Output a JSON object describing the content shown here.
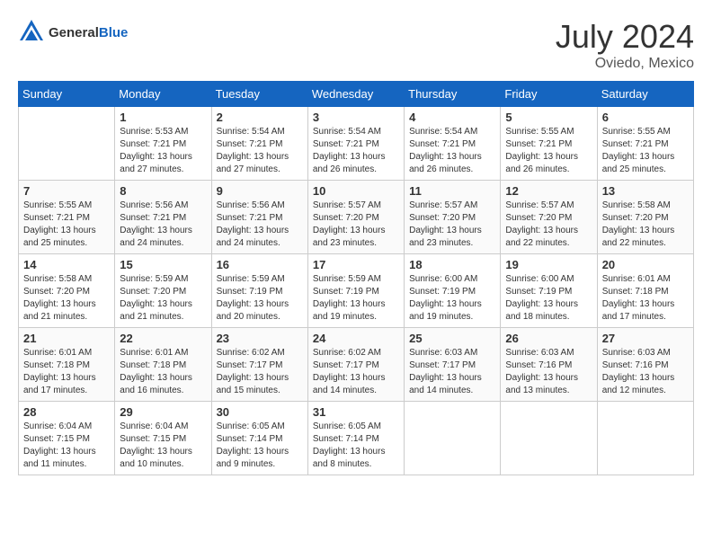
{
  "header": {
    "logo": {
      "general": "General",
      "blue": "Blue"
    },
    "title": "July 2024",
    "location": "Oviedo, Mexico"
  },
  "calendar": {
    "weekdays": [
      "Sunday",
      "Monday",
      "Tuesday",
      "Wednesday",
      "Thursday",
      "Friday",
      "Saturday"
    ],
    "weeks": [
      [
        {
          "day": "",
          "sunrise": "",
          "sunset": "",
          "daylight": ""
        },
        {
          "day": "1",
          "sunrise": "Sunrise: 5:53 AM",
          "sunset": "Sunset: 7:21 PM",
          "daylight": "Daylight: 13 hours and 27 minutes."
        },
        {
          "day": "2",
          "sunrise": "Sunrise: 5:54 AM",
          "sunset": "Sunset: 7:21 PM",
          "daylight": "Daylight: 13 hours and 27 minutes."
        },
        {
          "day": "3",
          "sunrise": "Sunrise: 5:54 AM",
          "sunset": "Sunset: 7:21 PM",
          "daylight": "Daylight: 13 hours and 26 minutes."
        },
        {
          "day": "4",
          "sunrise": "Sunrise: 5:54 AM",
          "sunset": "Sunset: 7:21 PM",
          "daylight": "Daylight: 13 hours and 26 minutes."
        },
        {
          "day": "5",
          "sunrise": "Sunrise: 5:55 AM",
          "sunset": "Sunset: 7:21 PM",
          "daylight": "Daylight: 13 hours and 26 minutes."
        },
        {
          "day": "6",
          "sunrise": "Sunrise: 5:55 AM",
          "sunset": "Sunset: 7:21 PM",
          "daylight": "Daylight: 13 hours and 25 minutes."
        }
      ],
      [
        {
          "day": "7",
          "sunrise": "Sunrise: 5:55 AM",
          "sunset": "Sunset: 7:21 PM",
          "daylight": "Daylight: 13 hours and 25 minutes."
        },
        {
          "day": "8",
          "sunrise": "Sunrise: 5:56 AM",
          "sunset": "Sunset: 7:21 PM",
          "daylight": "Daylight: 13 hours and 24 minutes."
        },
        {
          "day": "9",
          "sunrise": "Sunrise: 5:56 AM",
          "sunset": "Sunset: 7:21 PM",
          "daylight": "Daylight: 13 hours and 24 minutes."
        },
        {
          "day": "10",
          "sunrise": "Sunrise: 5:57 AM",
          "sunset": "Sunset: 7:20 PM",
          "daylight": "Daylight: 13 hours and 23 minutes."
        },
        {
          "day": "11",
          "sunrise": "Sunrise: 5:57 AM",
          "sunset": "Sunset: 7:20 PM",
          "daylight": "Daylight: 13 hours and 23 minutes."
        },
        {
          "day": "12",
          "sunrise": "Sunrise: 5:57 AM",
          "sunset": "Sunset: 7:20 PM",
          "daylight": "Daylight: 13 hours and 22 minutes."
        },
        {
          "day": "13",
          "sunrise": "Sunrise: 5:58 AM",
          "sunset": "Sunset: 7:20 PM",
          "daylight": "Daylight: 13 hours and 22 minutes."
        }
      ],
      [
        {
          "day": "14",
          "sunrise": "Sunrise: 5:58 AM",
          "sunset": "Sunset: 7:20 PM",
          "daylight": "Daylight: 13 hours and 21 minutes."
        },
        {
          "day": "15",
          "sunrise": "Sunrise: 5:59 AM",
          "sunset": "Sunset: 7:20 PM",
          "daylight": "Daylight: 13 hours and 21 minutes."
        },
        {
          "day": "16",
          "sunrise": "Sunrise: 5:59 AM",
          "sunset": "Sunset: 7:19 PM",
          "daylight": "Daylight: 13 hours and 20 minutes."
        },
        {
          "day": "17",
          "sunrise": "Sunrise: 5:59 AM",
          "sunset": "Sunset: 7:19 PM",
          "daylight": "Daylight: 13 hours and 19 minutes."
        },
        {
          "day": "18",
          "sunrise": "Sunrise: 6:00 AM",
          "sunset": "Sunset: 7:19 PM",
          "daylight": "Daylight: 13 hours and 19 minutes."
        },
        {
          "day": "19",
          "sunrise": "Sunrise: 6:00 AM",
          "sunset": "Sunset: 7:19 PM",
          "daylight": "Daylight: 13 hours and 18 minutes."
        },
        {
          "day": "20",
          "sunrise": "Sunrise: 6:01 AM",
          "sunset": "Sunset: 7:18 PM",
          "daylight": "Daylight: 13 hours and 17 minutes."
        }
      ],
      [
        {
          "day": "21",
          "sunrise": "Sunrise: 6:01 AM",
          "sunset": "Sunset: 7:18 PM",
          "daylight": "Daylight: 13 hours and 17 minutes."
        },
        {
          "day": "22",
          "sunrise": "Sunrise: 6:01 AM",
          "sunset": "Sunset: 7:18 PM",
          "daylight": "Daylight: 13 hours and 16 minutes."
        },
        {
          "day": "23",
          "sunrise": "Sunrise: 6:02 AM",
          "sunset": "Sunset: 7:17 PM",
          "daylight": "Daylight: 13 hours and 15 minutes."
        },
        {
          "day": "24",
          "sunrise": "Sunrise: 6:02 AM",
          "sunset": "Sunset: 7:17 PM",
          "daylight": "Daylight: 13 hours and 14 minutes."
        },
        {
          "day": "25",
          "sunrise": "Sunrise: 6:03 AM",
          "sunset": "Sunset: 7:17 PM",
          "daylight": "Daylight: 13 hours and 14 minutes."
        },
        {
          "day": "26",
          "sunrise": "Sunrise: 6:03 AM",
          "sunset": "Sunset: 7:16 PM",
          "daylight": "Daylight: 13 hours and 13 minutes."
        },
        {
          "day": "27",
          "sunrise": "Sunrise: 6:03 AM",
          "sunset": "Sunset: 7:16 PM",
          "daylight": "Daylight: 13 hours and 12 minutes."
        }
      ],
      [
        {
          "day": "28",
          "sunrise": "Sunrise: 6:04 AM",
          "sunset": "Sunset: 7:15 PM",
          "daylight": "Daylight: 13 hours and 11 minutes."
        },
        {
          "day": "29",
          "sunrise": "Sunrise: 6:04 AM",
          "sunset": "Sunset: 7:15 PM",
          "daylight": "Daylight: 13 hours and 10 minutes."
        },
        {
          "day": "30",
          "sunrise": "Sunrise: 6:05 AM",
          "sunset": "Sunset: 7:14 PM",
          "daylight": "Daylight: 13 hours and 9 minutes."
        },
        {
          "day": "31",
          "sunrise": "Sunrise: 6:05 AM",
          "sunset": "Sunset: 7:14 PM",
          "daylight": "Daylight: 13 hours and 8 minutes."
        },
        {
          "day": "",
          "sunrise": "",
          "sunset": "",
          "daylight": ""
        },
        {
          "day": "",
          "sunrise": "",
          "sunset": "",
          "daylight": ""
        },
        {
          "day": "",
          "sunrise": "",
          "sunset": "",
          "daylight": ""
        }
      ]
    ]
  }
}
